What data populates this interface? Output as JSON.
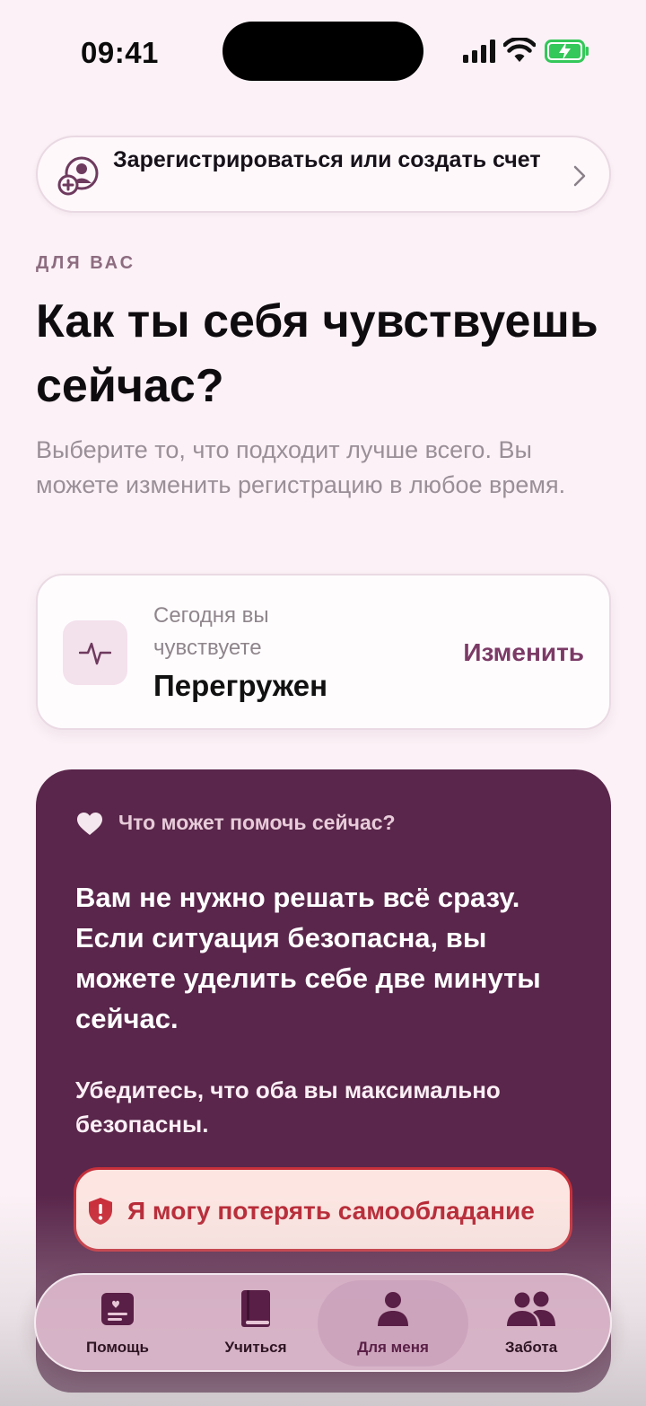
{
  "status_bar": {
    "time": "09:41"
  },
  "signin": {
    "label": "Зарегистрироваться или создать счет"
  },
  "section_label": "ДЛЯ ВАС",
  "headline": "Как ты себя чувствуешь сейчас?",
  "subtitle": "Выберите то, что подходит лучше всего. Вы можете изменить регистрацию в любое время.",
  "mood": {
    "prompt": "Сегодня вы чувствуете",
    "value": "Перегружен",
    "change_label": "Изменить"
  },
  "help": {
    "heading": "Что может помочь сейчас?",
    "body": "Вам не нужно решать всё сразу. Если ситуация безопасна, вы можете уделить себе две минуты сейчас.",
    "note": "Убедитесь, что оба вы максимально безопасны.",
    "crisis_label": "Я могу потерять самообладание"
  },
  "tabs": [
    {
      "label": "Помощь",
      "icon": "help-card-icon",
      "active": false
    },
    {
      "label": "Учиться",
      "icon": "book-icon",
      "active": false
    },
    {
      "label": "Для меня",
      "icon": "person-icon",
      "active": true
    },
    {
      "label": "Забота",
      "icon": "people-icon",
      "active": false
    }
  ],
  "colors": {
    "background": "#fbf1f6",
    "accent": "#7b3a66",
    "help_card": "#5a264b",
    "crisis": "#b72633",
    "battery": "#34c759"
  }
}
